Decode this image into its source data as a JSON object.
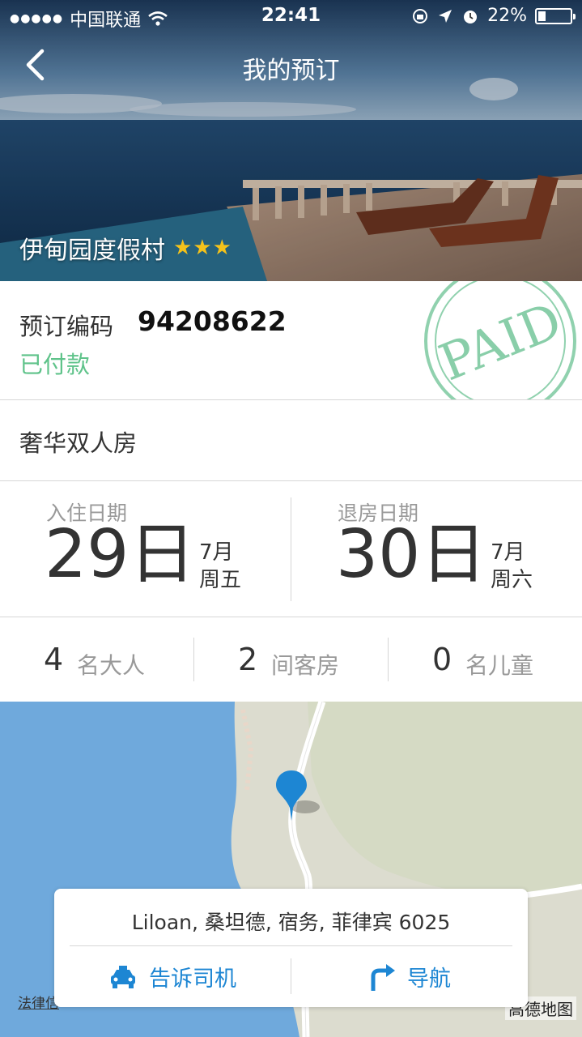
{
  "status_bar": {
    "carrier": "中国联通",
    "time": "22:41",
    "battery": "22%",
    "battery_level": 0.22
  },
  "nav": {
    "title": "我的预订"
  },
  "hotel": {
    "name": "伊甸园度假村",
    "stars": "★★★"
  },
  "booking": {
    "code_label": "预订编码",
    "code": "94208622",
    "status": "已付款",
    "stamp_text": "PAID"
  },
  "room": {
    "name": "奢华双人房"
  },
  "dates": {
    "checkin": {
      "label": "入住日期",
      "day": "29日",
      "month": "7月",
      "weekday": "周五"
    },
    "checkout": {
      "label": "退房日期",
      "day": "30日",
      "month": "7月",
      "weekday": "周六"
    }
  },
  "counts": {
    "adults": {
      "num": "4",
      "label": "名大人"
    },
    "rooms": {
      "num": "2",
      "label": "间客房"
    },
    "children": {
      "num": "0",
      "label": "名儿童"
    }
  },
  "map": {
    "address": "Liloan, 桑坦德, 宿务, 菲律宾 6025",
    "tell_driver": "告诉司机",
    "navigate": "导航",
    "legal": "法律信",
    "logo": "高德地图"
  },
  "colors": {
    "accent": "#1d86d3",
    "paid": "#5fc38a",
    "stars": "#f4c21b",
    "water": "#6fa9dc"
  }
}
